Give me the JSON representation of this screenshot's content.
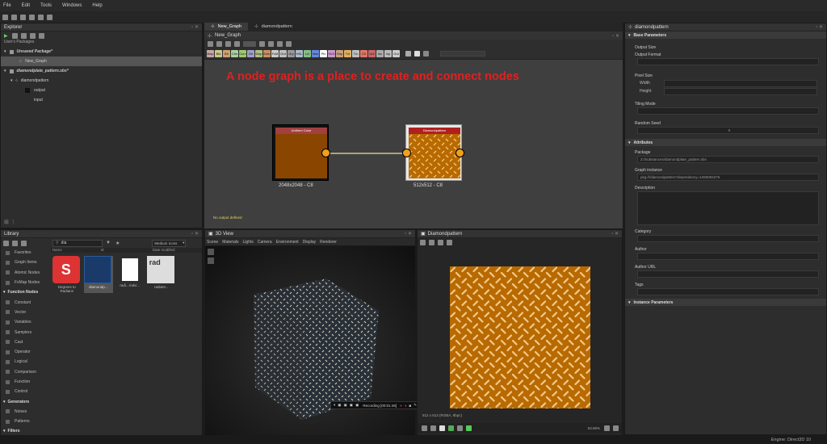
{
  "menu": [
    "File",
    "Edit",
    "Tools",
    "Windows",
    "Help"
  ],
  "explorer": {
    "title": "Explorer",
    "user_packages": "User's Packages",
    "items": [
      {
        "label": "Unsaved Package*",
        "bold": true
      },
      {
        "label": "New_Graph",
        "bold": false
      },
      {
        "label": "diamondplate_pattern.sbs*",
        "bold": true
      },
      {
        "label": "diamondpattern",
        "bold": false
      },
      {
        "label": "output",
        "bold": false
      },
      {
        "label": "input",
        "bold": false
      }
    ]
  },
  "graph": {
    "tabs": [
      "New_Graph",
      "diamondpattern"
    ],
    "subtitle": "New_Graph",
    "annotation": "A node graph is a place to create and connect nodes",
    "node_buttons": [
      {
        "label": "Bmp",
        "color": "#c9a5a5"
      },
      {
        "label": "Bld",
        "color": "#c9c98a"
      },
      {
        "label": "Blr",
        "color": "#d0a070"
      },
      {
        "label": "Chn",
        "color": "#a8d0a0"
      },
      {
        "label": "Curv",
        "color": "#a0c870"
      },
      {
        "label": "Dir",
        "color": "#a0a0c8"
      },
      {
        "label": "Dwp",
        "color": "#b0c080"
      },
      {
        "label": "Emb",
        "color": "#c89060"
      },
      {
        "label": "FxM",
        "color": "#cccccc"
      },
      {
        "label": "Grd",
        "color": "#c0c0c0"
      },
      {
        "label": "Gry",
        "color": "#999999"
      },
      {
        "label": "HSL",
        "color": "#aabbcc"
      },
      {
        "label": "Lvl",
        "color": "#88bb88"
      },
      {
        "label": "Nrm",
        "color": "#6688dd"
      },
      {
        "label": "Pix",
        "color": "#ffffff"
      },
      {
        "label": "SVG",
        "color": "#cc99cc"
      },
      {
        "label": "Shp",
        "color": "#c8a080"
      },
      {
        "label": "Txt",
        "color": "#e0b060"
      },
      {
        "label": "Trn",
        "color": "#c0c0c0"
      },
      {
        "label": "Clr",
        "color": "#dd7766"
      },
      {
        "label": "Unf",
        "color": "#cc6666"
      },
      {
        "label": "Inc",
        "color": "#aaaaaa"
      },
      {
        "label": "Inp",
        "color": "#bbbbbb"
      },
      {
        "label": "Out",
        "color": "#cccccc"
      }
    ],
    "node1": {
      "title": "Uniform Color",
      "res": "2048x2048 - C8"
    },
    "node2": {
      "title": "Diamondpattern",
      "res": "512x512 - C8"
    },
    "status": "No output defined"
  },
  "library": {
    "title": "Library",
    "search_value": "dia",
    "view_mode": "Medium Icons",
    "columns": [
      "Name",
      "Id",
      "Date modified"
    ],
    "categories": [
      {
        "label": "Favorites",
        "hdr": false
      },
      {
        "label": "Graph Items",
        "hdr": false
      },
      {
        "label": "Atomic Nodes",
        "hdr": false
      },
      {
        "label": "FxMap Nodes",
        "hdr": false
      },
      {
        "label": "Function Nodes",
        "hdr": true
      },
      {
        "label": "Constant",
        "hdr": false
      },
      {
        "label": "Vector",
        "hdr": false
      },
      {
        "label": "Variables",
        "hdr": false
      },
      {
        "label": "Samplers",
        "hdr": false
      },
      {
        "label": "Cast",
        "hdr": false
      },
      {
        "label": "Operator",
        "hdr": false
      },
      {
        "label": "Logical",
        "hdr": false
      },
      {
        "label": "Comparison",
        "hdr": false
      },
      {
        "label": "Function",
        "hdr": false
      },
      {
        "label": "Control",
        "hdr": false
      },
      {
        "label": "Generators",
        "hdr": true
      },
      {
        "label": "Noises",
        "hdr": false
      },
      {
        "label": "Patterns",
        "hdr": false
      },
      {
        "label": "Filters",
        "hdr": true
      }
    ],
    "thumbs": [
      {
        "label": "Degrees to Radians"
      },
      {
        "label": "diamondp..."
      },
      {
        "label": "radi...rndvi..."
      },
      {
        "label": "radiant..."
      }
    ]
  },
  "view3d": {
    "title": "3D View",
    "menu": [
      "Scene",
      "Materials",
      "Lights",
      "Camera",
      "Environment",
      "Display",
      "Renderer"
    ],
    "recording": "Recording [00:01:46]"
  },
  "view2d": {
    "title": "Diamondpattern",
    "info": "512 x 512 (RGBA, 8bpc)",
    "zoom": "63.86%"
  },
  "properties": {
    "title": "diamondpattern",
    "base_params": "Base Parameters",
    "output_size": "Output Size",
    "output_format": "Output Format",
    "pixel_size": "Pixel Size",
    "width": "Width",
    "height": "Height",
    "tiling_mode": "Tiling Mode",
    "random_seed": "Random Seed",
    "seed_value": "0",
    "attributes": "Attributes",
    "package": "Package",
    "package_value": "Z:/Substances/diamondplate_pattern.sbs",
    "graph_instance": "Graph instance",
    "graph_instance_value": "pkg:///diamondpattern?dependency=1296094276",
    "description": "Description",
    "category": "Category",
    "author": "Author",
    "author_url": "Author URL",
    "tags": "Tags",
    "instance_params": "Instance Parameters"
  },
  "engine": "Engine: Direct3D 10"
}
